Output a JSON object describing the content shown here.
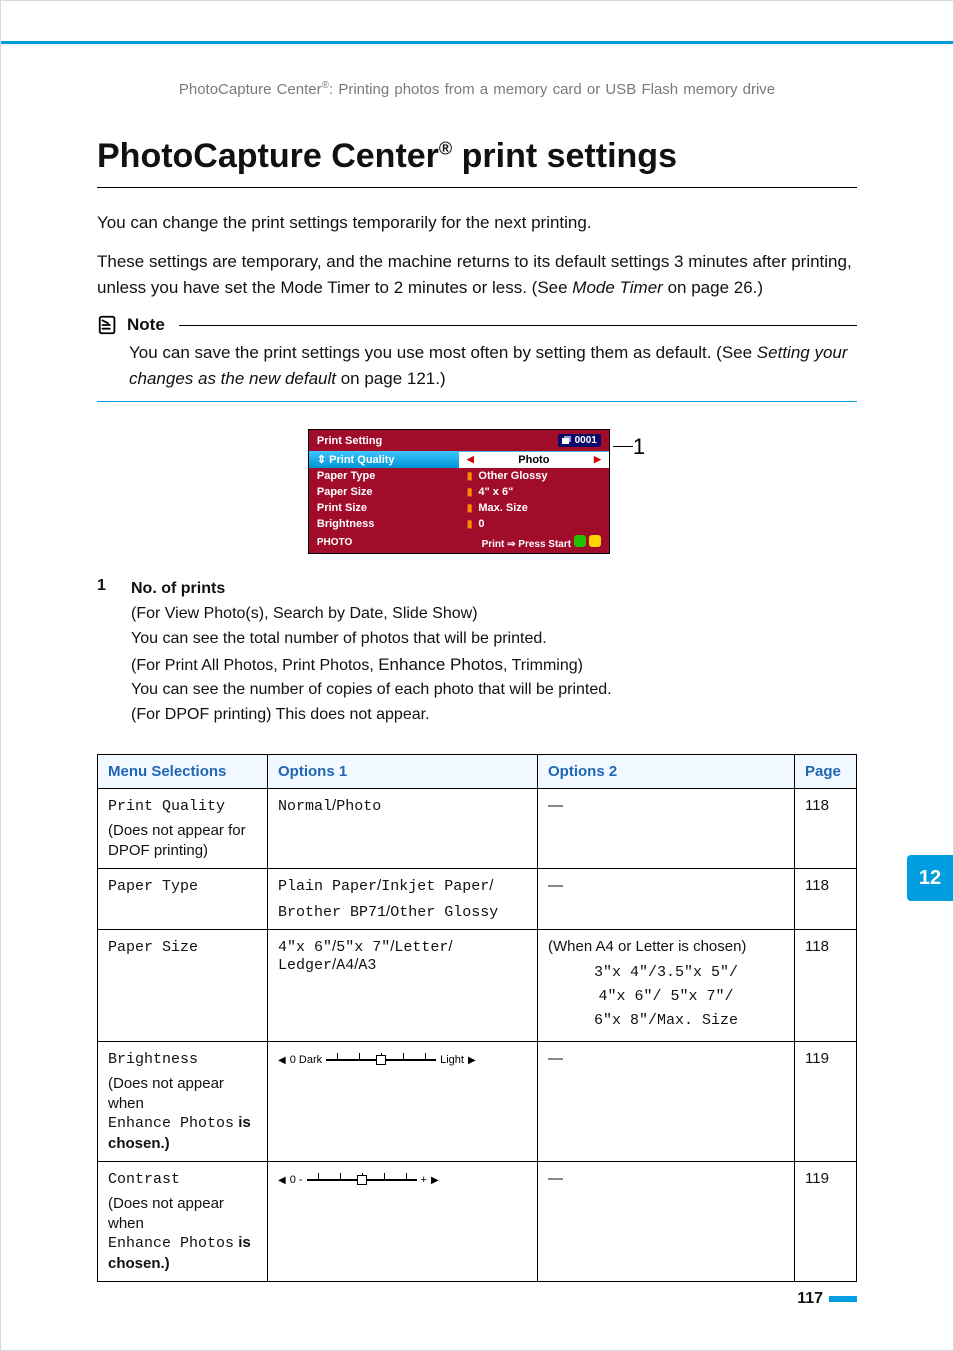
{
  "running_head": {
    "prefix": "PhotoCapture Center",
    "sup": "®",
    "suffix": ": Printing photos from a memory card or USB Flash memory drive"
  },
  "h1": {
    "prefix": "PhotoCapture Center",
    "sup": "®",
    "suffix": " print settings"
  },
  "paragraphs": {
    "p1": "You can change the print settings temporarily for the next printing.",
    "p2_a": "These settings are temporary, and the machine returns to its default settings 3 minutes after printing, unless you have set the Mode Timer to 2 minutes or less. (See ",
    "p2_em": "Mode Timer",
    "p2_b": " on page 26.)"
  },
  "note": {
    "label": "Note",
    "a": "You can save the print settings you use most often by setting them as default. (See ",
    "em": "Setting your changes as the new default",
    "b": " on page 121.)"
  },
  "device": {
    "title": "Print Setting",
    "badge": "0001",
    "rows": [
      {
        "label": "Print Quality",
        "value": "Photo",
        "selected": true
      },
      {
        "label": "Paper Type",
        "value": "Other Glossy"
      },
      {
        "label": "Paper Size",
        "value": "4\" x 6\""
      },
      {
        "label": "Print Size",
        "value": "Max. Size"
      },
      {
        "label": "Brightness",
        "value": "0"
      }
    ],
    "footer_left": "PHOTO",
    "footer_right": "Print ⇒ Press Start",
    "callout": "1"
  },
  "defs": {
    "num": "1",
    "title": "No. of prints",
    "lines": [
      "(For View Photo(s), Search by Date, Slide Show)",
      "You can see the total number of photos that will be printed.",
      {
        "pre": "(For Print All Photos, Print Photos, ",
        "mid": "Enhance Photos",
        "post": ", Trimming)"
      },
      "You can see the number of copies of each photo that will be printed.",
      "(For DPOF printing) This does not appear."
    ]
  },
  "table": {
    "headers": {
      "c1": "Menu Selections",
      "c2": "Options 1",
      "c3": "Options 2",
      "c4": "Page"
    },
    "rows": [
      {
        "menu": "Print Quality",
        "menu_note": "(Does not appear for DPOF printing)",
        "opt1_mono": [
          "Normal",
          "/",
          "Photo"
        ],
        "opt2_top": "—",
        "page": "118"
      },
      {
        "menu": "Paper Type",
        "opt1_lines": [
          [
            "Plain Paper",
            "/",
            "Inkjet Paper",
            "/"
          ],
          [
            "Brother BP71",
            "/",
            "Other Glossy"
          ]
        ],
        "opt2_top": "—",
        "page": "118"
      },
      {
        "menu": "Paper Size",
        "opt1_lines": [
          [
            "4\"x 6\"",
            "/",
            "5\"x 7\"",
            "/",
            "Letter",
            "/"
          ],
          [
            "Ledger",
            "/",
            "A4",
            "/",
            "A3"
          ]
        ],
        "opt2_top": "(When A4 or Letter is chosen)",
        "opt2_mono": [
          "3\"x 4\"/3.5\"x 5\"/",
          "4\"x 6\"/  5\"x 7\"/",
          "6\"x 8\"/Max. Size"
        ],
        "page": "118"
      },
      {
        "menu": "Brightness",
        "menu_note_lines": [
          "(Does not appear when",
          "Enhance Photos",
          " is chosen.)"
        ],
        "slider_left": "0 Dark",
        "slider_right": "Light",
        "opt2_top": "—",
        "page": "119"
      },
      {
        "menu": "Contrast",
        "menu_note_lines": [
          "(Does not appear when",
          "Enhance Photos",
          " is chosen.)"
        ],
        "slider_left": "0 -",
        "slider_right": "+",
        "opt2_top": "—",
        "page": "119"
      }
    ]
  },
  "side_tab": "12",
  "page_number": "117"
}
